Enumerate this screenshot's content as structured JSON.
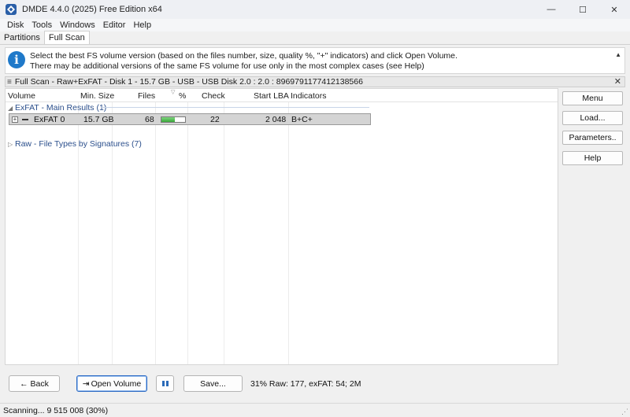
{
  "window": {
    "title": "DMDE 4.4.0 (2025) Free Edition x64",
    "minimize": "—",
    "maximize": "☐",
    "close": "✕"
  },
  "menu": [
    "Disk",
    "Tools",
    "Windows",
    "Editor",
    "Help"
  ],
  "tabs": [
    "Partitions",
    "Full Scan"
  ],
  "active_tab": "Full Scan",
  "info": {
    "line1": "Select the best FS volume version (based on the files number, size, quality %, \"+\" indicators) and click Open Volume.",
    "line2": "There may be additional versions of the same FS volume for use only in the most complex cases (see Help)",
    "collapse": "▲"
  },
  "scan_header": {
    "grip": "≡",
    "text": "Full Scan - Raw+ExFAT - Disk 1 - 15.7 GB - USB - USB Disk 2.0 : 2.0 : 8969791177412138566",
    "close": "✕"
  },
  "columns": [
    "Volume",
    "Min. Size",
    "Files",
    "%",
    "Check",
    "Start LBA",
    "Indicators"
  ],
  "groups": {
    "main": {
      "arrow": "◢",
      "label": "ExFAT - Main Results (1)"
    },
    "raw": {
      "arrow": "▷",
      "label": "Raw - File Types by Signatures (7)"
    }
  },
  "row": {
    "expand": "+",
    "volume": "ExFAT 0",
    "min_size": "15.7 GB",
    "files": "68",
    "quality": 0.55,
    "check": "22",
    "start_lba": "2 048",
    "indicators": "B+C+"
  },
  "side_buttons": [
    "Menu",
    "Load...",
    "Parameters..",
    "Help"
  ],
  "bottom": {
    "back": "← Back",
    "open_volume": "Open Volume",
    "open_icon": "⇥",
    "save": "Save...",
    "progress_text": "31% Raw: 177, exFAT: 54; 2M"
  },
  "status": "Scanning... 9 515 008 (30%)",
  "colors": {
    "accent": "#1f79c9",
    "progress": "#3aa83a"
  }
}
